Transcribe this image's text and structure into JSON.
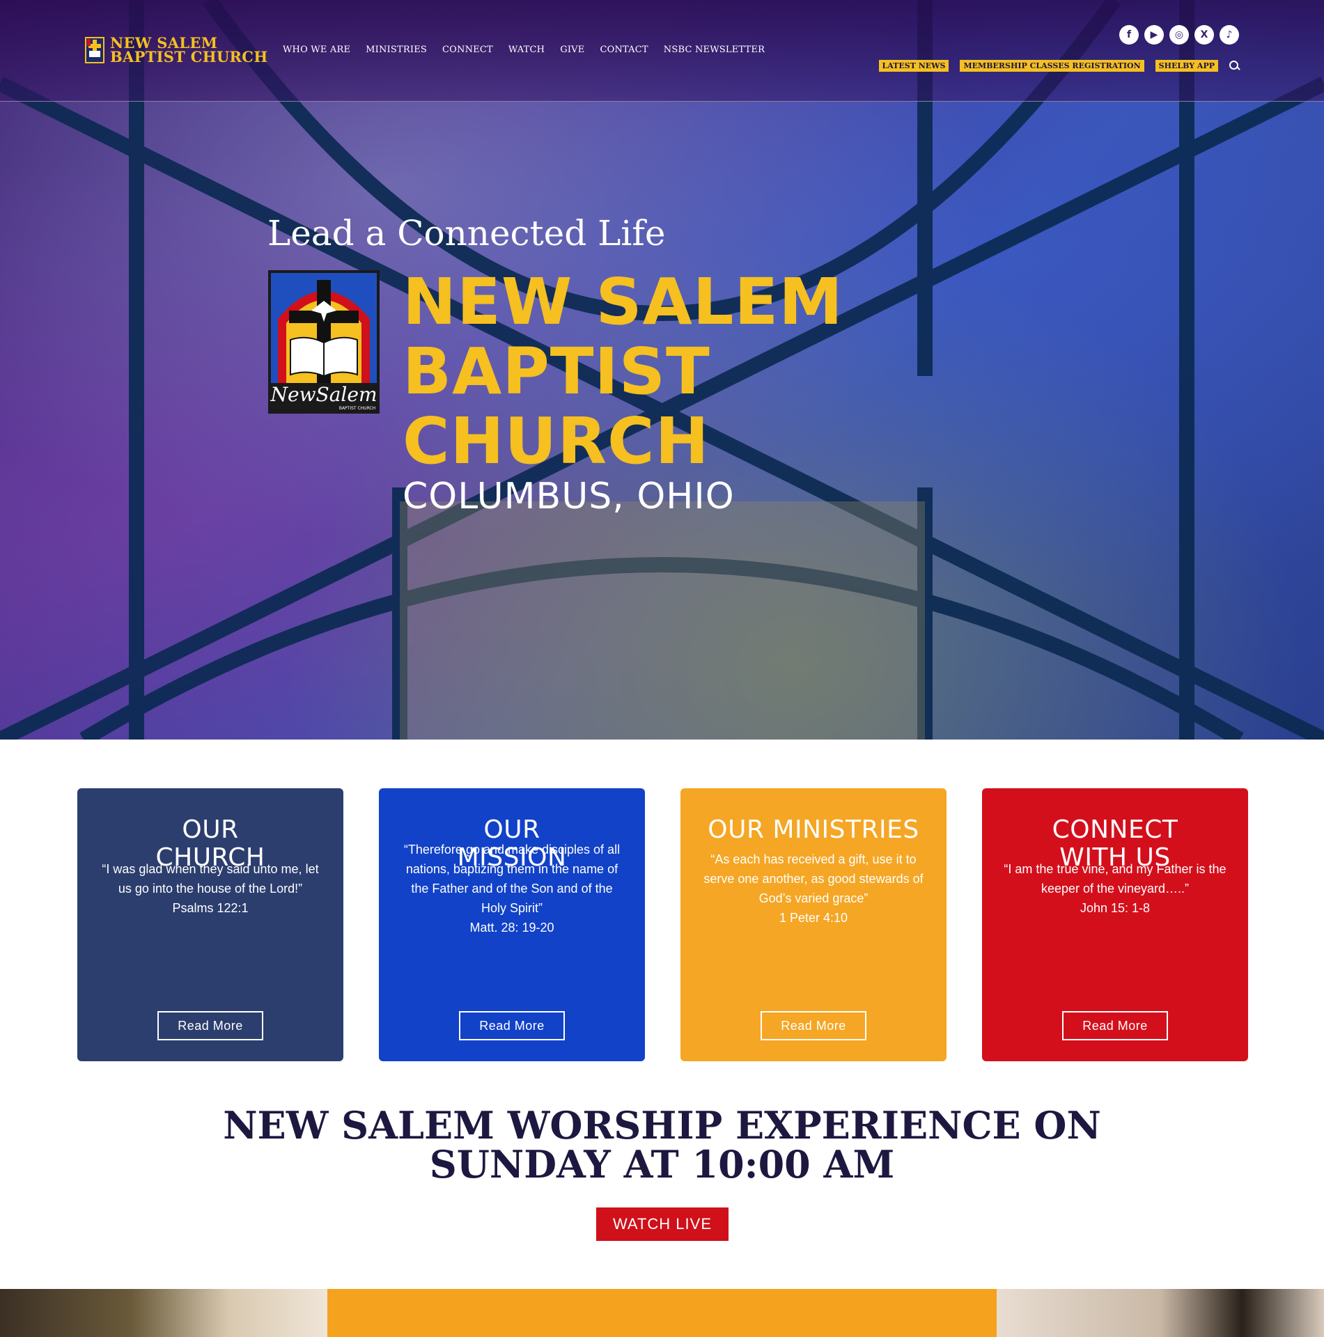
{
  "header": {
    "logo_line1": "NEW SALEM",
    "logo_line2": "BAPTIST CHURCH",
    "nav": [
      "WHO WE ARE",
      "MINISTRIES",
      "CONNECT",
      "WATCH",
      "GIVE",
      "CONTACT",
      "NSBC NEWSLETTER"
    ],
    "social": [
      {
        "name": "facebook-icon",
        "glyph": "f"
      },
      {
        "name": "youtube-icon",
        "glyph": "▶"
      },
      {
        "name": "instagram-icon",
        "glyph": "◎"
      },
      {
        "name": "x-icon",
        "glyph": "X"
      },
      {
        "name": "tiktok-icon",
        "glyph": "♪"
      }
    ],
    "quick_links": [
      "LATEST NEWS",
      "MEMBERSHIP CLASSES REGISTRATION",
      "SHELBY APP"
    ]
  },
  "hero": {
    "tagline": "Lead a Connected Life",
    "title_lines": [
      "NEW SALEM",
      "BAPTIST",
      "CHURCH"
    ],
    "city": "COLUMBUS, OHIO",
    "badge_script": "NewSalem",
    "badge_sub": "BAPTIST CHURCH"
  },
  "cards": [
    {
      "title": "OUR\nCHURCH",
      "quote": "“I was glad when they said unto me, let us go into the house of the Lord!”",
      "ref": "Psalms 122:1",
      "button": "Read More",
      "color": "#2c3e6e"
    },
    {
      "title": "OUR\nMISSION",
      "quote": "“Therefore go and make disciples of all nations, baptizing them in the name of the Father and of the Son and of the Holy Spirit”",
      "ref": "Matt. 28: 19-20",
      "button": "Read More",
      "color": "#1142c8"
    },
    {
      "title": "OUR MINISTRIES",
      "quote": "“As each has received a gift, use it to serve one another, as good stewards of God’s varied grace”",
      "ref": "1 Peter 4:10",
      "button": "Read More",
      "color": "#f5a624"
    },
    {
      "title": "CONNECT\nWITH US",
      "quote": "“I am the true vine, and my Father is the keeper of the vineyard…..”",
      "ref": "John 15: 1-8",
      "button": "Read More",
      "color": "#d40f1c"
    }
  ],
  "worship": {
    "line1": "NEW SALEM WORSHIP EXPERIENCE ON",
    "line2": "SUNDAY AT 10:00 AM",
    "button": "WATCH LIVE"
  },
  "colors": {
    "gold": "#f5c020",
    "navy": "#1c1840",
    "red": "#d0101a"
  }
}
